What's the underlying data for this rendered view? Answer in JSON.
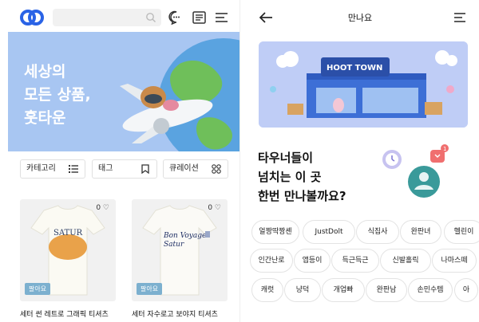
{
  "left": {
    "search": {
      "placeholder": ""
    },
    "hero": {
      "title": "세상의\n모든 상품,\n훗타운"
    },
    "chips": [
      {
        "label": "카테고리",
        "icon": "list-icon"
      },
      {
        "label": "태그",
        "icon": "bookmark-icon"
      },
      {
        "label": "큐레이션",
        "icon": "grid-icon"
      }
    ],
    "products": [
      {
        "likes": "0",
        "badge": "팔아요",
        "title": "세터 썬 레트로 그래픽 티셔츠",
        "print_text": "SATUR"
      },
      {
        "likes": "0",
        "badge": "팔아요",
        "title": "세터 자수로고 보야지 티셔츠",
        "print_text": "Bon Voyage\nSatur"
      }
    ]
  },
  "right": {
    "title": "만나요",
    "hero": {
      "sign_text": "HOOT TOWN"
    },
    "headline": "타우너들이\n넘치는 이 곳\n한번 만나볼까요?",
    "notification_count": "1",
    "tag_rows": [
      [
        "얼짱딱짱셴",
        "JustDolt",
        "식집사",
        "완판녀",
        "헬린이"
      ],
      [
        "인간난로",
        "앱등이",
        "득근득근",
        "신발홀릭",
        "나마스떼"
      ],
      [
        "캐럿",
        "냥덕",
        "개업빠",
        "완판남",
        "손민수템",
        "아"
      ]
    ]
  },
  "colors": {
    "hero_blue": "#a8c6f2",
    "badge_blue": "#7cb0cf",
    "teal": "#3a9a9a"
  }
}
